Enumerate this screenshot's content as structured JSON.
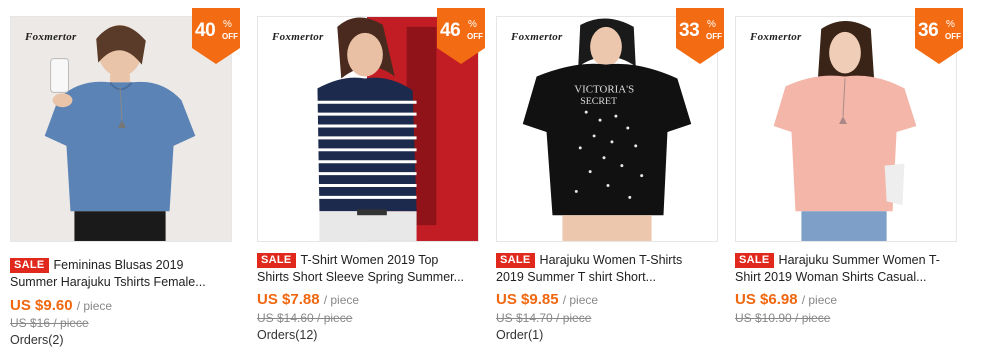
{
  "products": [
    {
      "brand": "Foxmertor",
      "discount_num": "40",
      "discount_pct": "%",
      "discount_off": "OFF",
      "sale_label": "SALE",
      "title_line1": "Femininas Blusas 2019",
      "title_line2": "Summer Harajuku Tshirts Female...",
      "price": "US $9.60",
      "per": "/ piece",
      "old_price": "US $16 / piece",
      "orders": "Orders(2)",
      "shirt_color": "#5b83b5"
    },
    {
      "brand": "Foxmertor",
      "discount_num": "46",
      "discount_pct": "%",
      "discount_off": "OFF",
      "sale_label": "SALE",
      "title_line1": "T-Shirt Women 2019 Top",
      "title_line2": "Shirts Short Sleeve Spring Summer...",
      "price": "US $7.88",
      "per": "/ piece",
      "old_price": "US $14.60 / piece",
      "orders": "Orders(12)",
      "shirt_color": "#1c2a4e"
    },
    {
      "brand": "Foxmertor",
      "discount_num": "33",
      "discount_pct": "%",
      "discount_off": "OFF",
      "sale_label": "SALE",
      "title_line1": "Harajuku Women T-Shirts",
      "title_line2": "2019 Summer T shirt Short...",
      "price": "US $9.85",
      "per": "/ piece",
      "old_price": "US $14.70 / piece",
      "orders": "Order(1)",
      "shirt_color": "#111111"
    },
    {
      "brand": "Foxmertor",
      "discount_num": "36",
      "discount_pct": "%",
      "discount_off": "OFF",
      "sale_label": "SALE",
      "title_line1": "Harajuku Summer Women T-",
      "title_line2": "Shirt 2019 Woman Shirts Casual...",
      "price": "US $6.98",
      "per": "/ piece",
      "old_price": "US $10.90 / piece",
      "orders": "Orders(2)",
      "shirt_color": "#f3b6a8"
    }
  ],
  "colors": {
    "badge": "#f36b12",
    "sale": "#e0281c",
    "price": "#f0670f"
  }
}
